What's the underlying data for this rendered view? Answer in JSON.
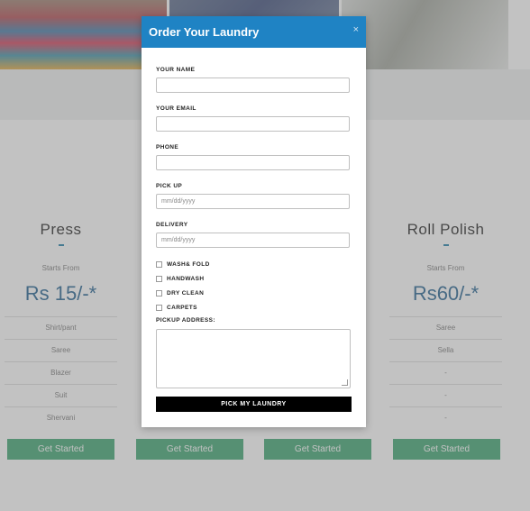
{
  "columns": [
    {
      "title": "Press",
      "starts": "Starts From",
      "price": "Rs 15/-*",
      "items": [
        "Shirt/pant",
        "Saree",
        "Blazer",
        "Suit",
        "Shervani"
      ],
      "button": "Get Started"
    },
    {
      "title": "",
      "starts": "",
      "price": "",
      "items": [],
      "button": "Get Started"
    },
    {
      "title": "",
      "starts": "",
      "price": "",
      "items": [],
      "button": "Get Started"
    },
    {
      "title": "Roll Polish",
      "starts": "Starts From",
      "price": "Rs60/-*",
      "items": [
        "Saree",
        "Sella",
        "-",
        "-",
        "-"
      ],
      "button": "Get Started"
    }
  ],
  "modal": {
    "title": "Order Your Laundry",
    "close": "×",
    "fields": {
      "name_label": "YOUR NAME",
      "email_label": "YOUR EMAIL",
      "phone_label": "PHONE",
      "pickup_label": "PICK UP",
      "pickup_placeholder": "mm/dd/yyyy",
      "delivery_label": "DELIVERY",
      "delivery_placeholder": "mm/dd/yyyy"
    },
    "services": [
      "WASH& FOLD",
      "HANDWASH",
      "DRY CLEAN",
      "CARPETS"
    ],
    "address_label": "PICKUP ADDRESS:",
    "submit": "PICK MY LAUNDRY"
  },
  "colors": {
    "header": "#1f83c4",
    "button": "#3ba46f",
    "price": "#1f5f8f",
    "submit": "#000000"
  }
}
